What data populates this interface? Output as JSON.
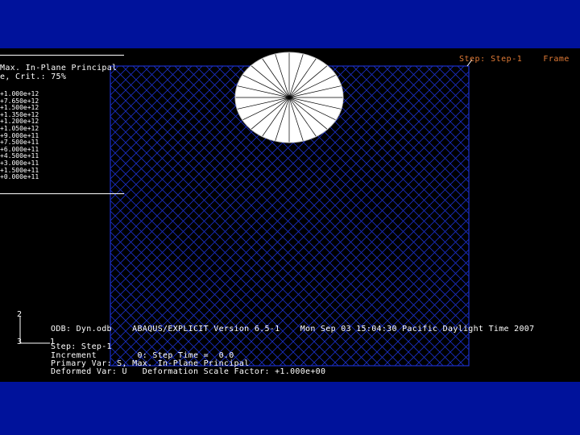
{
  "colors": {
    "frame": "#00129b",
    "viewport_bg": "#000000",
    "mesh": "#1a2fc8",
    "disk_fill": "#ffffff",
    "disk_lines": "#000000",
    "step_text": "#e07a36",
    "text": "#ffffff"
  },
  "legend": {
    "title_line1": "Max. In-Plane Principal",
    "title_line2": "e, Crit.: 75%",
    "values": [
      "+1.000e+12",
      "+7.650e+12",
      "+1.500e+12",
      "+1.350e+12",
      "+1.200e+12",
      "+1.050e+12",
      "+9.000e+11",
      "+7.500e+11",
      "+6.000e+11",
      "+4.500e+11",
      "+3.000e+11",
      "+1.500e+11",
      "+0.000e+11"
    ]
  },
  "step_label": "Step: Step-1    Frame",
  "triad": {
    "axis_2": "2",
    "axis_3": "3",
    "axis_1": "1"
  },
  "info": {
    "odb_line": "ODB: Dyn.odb    ABAQUS/EXPLICIT Version 6.5-1    Mon Sep 03 15:04:30 Pacific Daylight Time 2007",
    "step_line": "Step: Step-1",
    "increment_line": "Increment        0: Step Time =  0.0",
    "primary_var_line": "Primary Var: S, Max. In-Plane Principal",
    "deformed_var_line": "Deformed Var: U   Deformation Scale Factor: +1.000e+00"
  },
  "icons": {
    "triad": "coordinate-triad-icon",
    "impactor": "impactor-disk-shape",
    "plate": "meshed-plate-shape"
  }
}
